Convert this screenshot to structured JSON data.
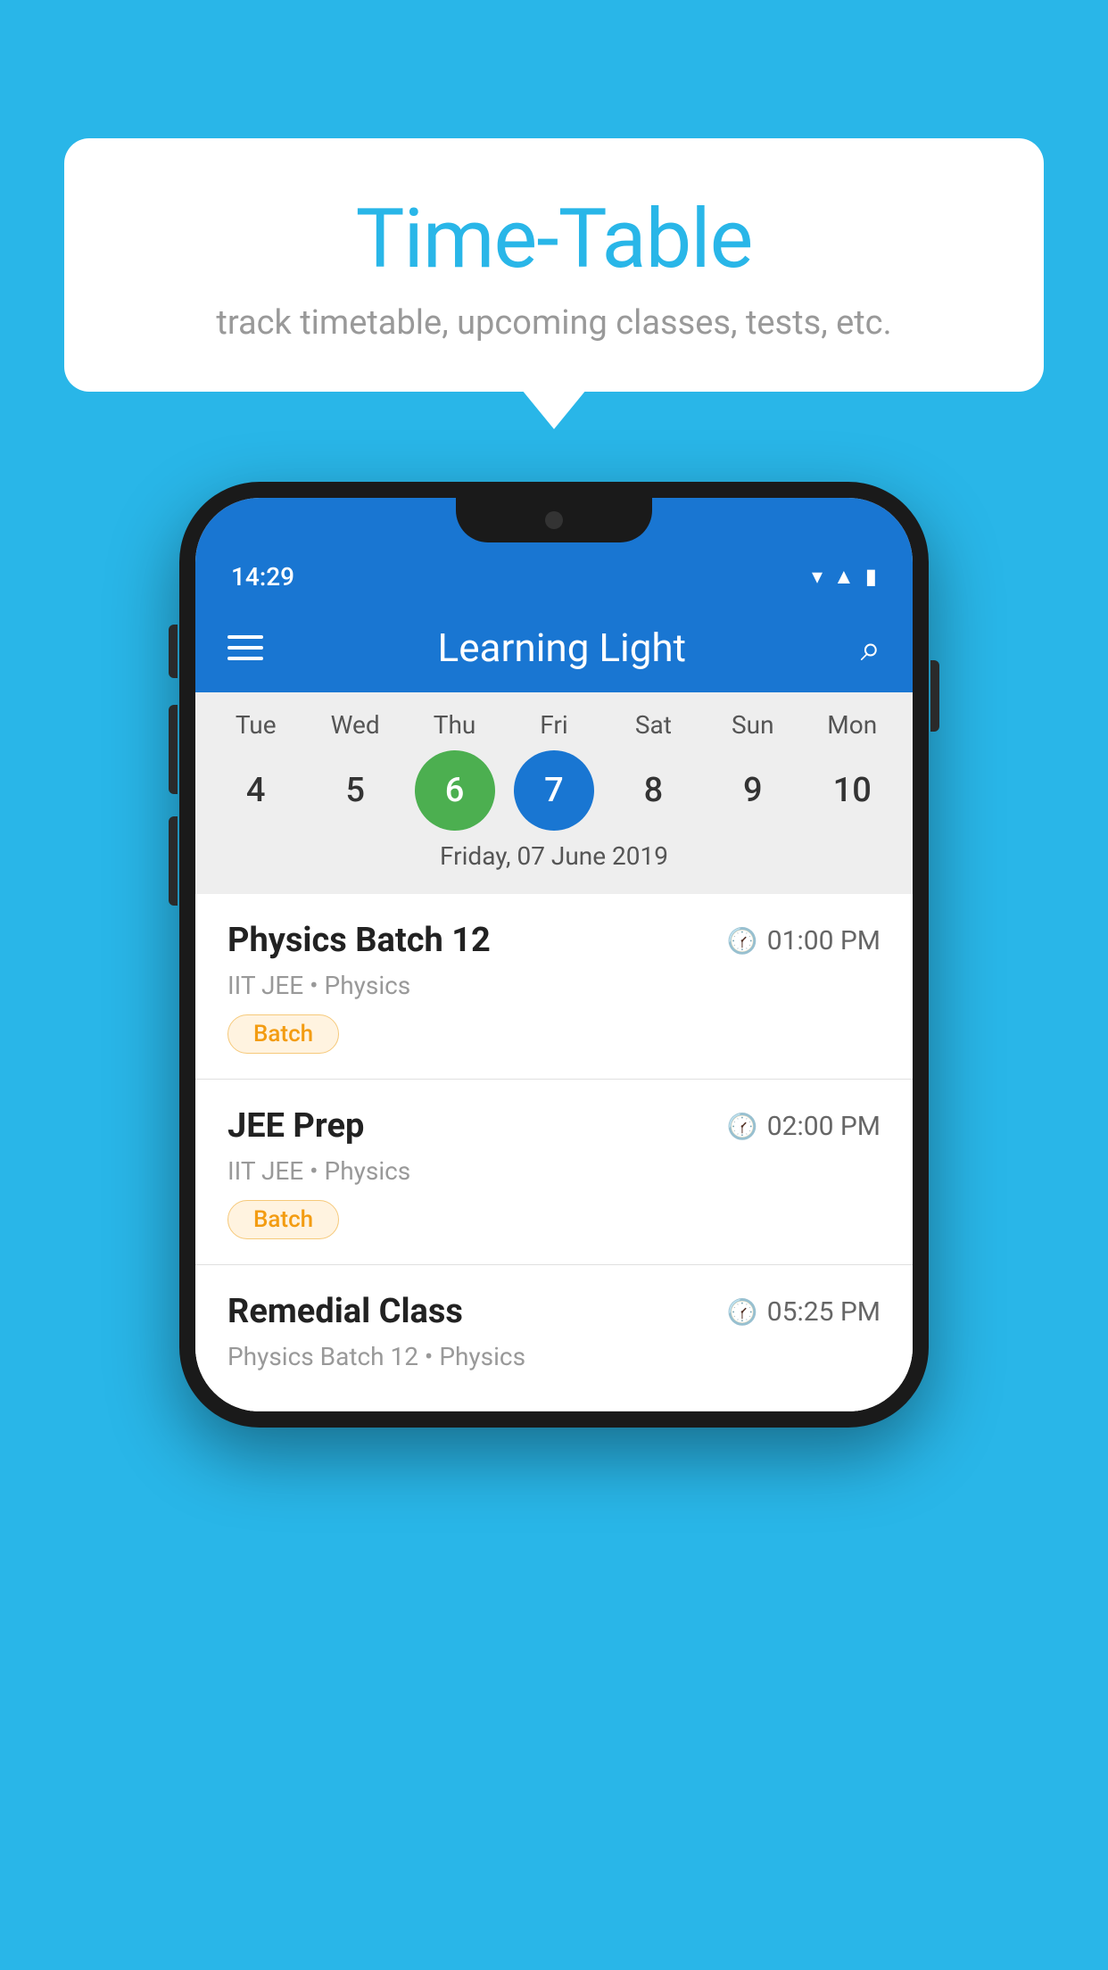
{
  "background_color": "#29b6e8",
  "bubble": {
    "title": "Time-Table",
    "subtitle": "track timetable, upcoming classes, tests, etc."
  },
  "phone": {
    "status_bar": {
      "time": "14:29"
    },
    "app_bar": {
      "title": "Learning Light"
    },
    "calendar": {
      "days": [
        {
          "label": "Tue",
          "num": "4"
        },
        {
          "label": "Wed",
          "num": "5"
        },
        {
          "label": "Thu",
          "num": "6",
          "state": "today"
        },
        {
          "label": "Fri",
          "num": "7",
          "state": "selected"
        },
        {
          "label": "Sat",
          "num": "8"
        },
        {
          "label": "Sun",
          "num": "9"
        },
        {
          "label": "Mon",
          "num": "10"
        }
      ],
      "selected_date": "Friday, 07 June 2019"
    },
    "schedule": [
      {
        "title": "Physics Batch 12",
        "time": "01:00 PM",
        "subtitle": "IIT JEE • Physics",
        "tag": "Batch"
      },
      {
        "title": "JEE Prep",
        "time": "02:00 PM",
        "subtitle": "IIT JEE • Physics",
        "tag": "Batch"
      },
      {
        "title": "Remedial Class",
        "time": "05:25 PM",
        "subtitle": "Physics Batch 12 • Physics",
        "tag": ""
      }
    ]
  }
}
